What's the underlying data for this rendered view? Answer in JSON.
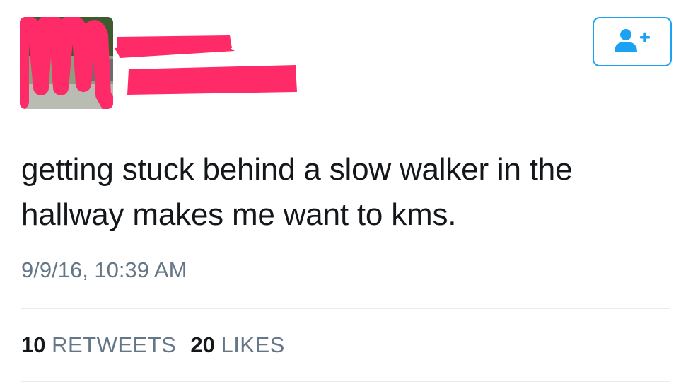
{
  "tweet": {
    "text": "getting stuck behind a slow walker in the hallway makes me want to kms.",
    "timestamp": "9/9/16, 10:39 AM"
  },
  "stats": {
    "retweets_count": "10",
    "retweets_label": "RETWEETS",
    "likes_count": "20",
    "likes_label": "LIKES"
  },
  "follow_button": {
    "icon": "add-user-icon"
  },
  "colors": {
    "accent": "#1da1f2",
    "redaction": "#ff2a68",
    "secondary_text": "#657786"
  }
}
